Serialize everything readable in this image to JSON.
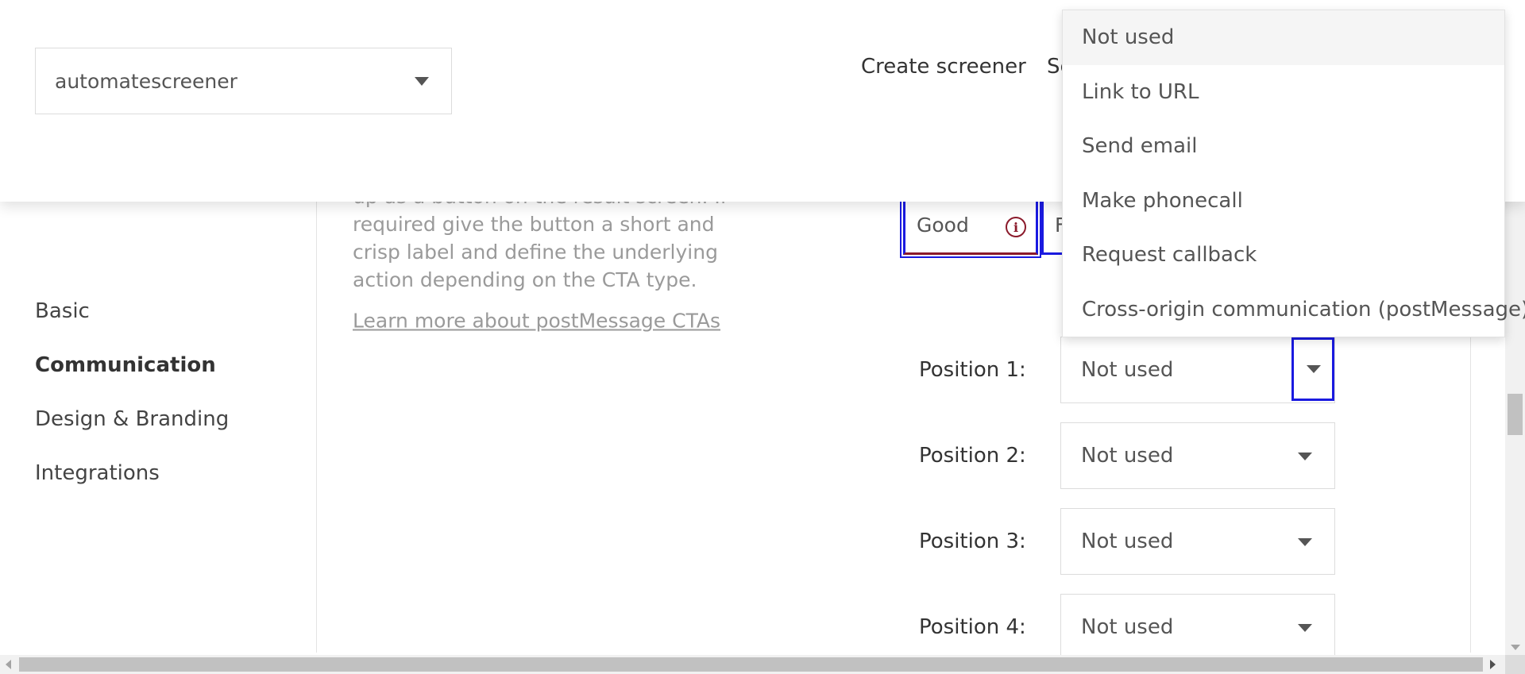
{
  "header": {
    "screener_select": {
      "value": "automatescreener"
    },
    "nav": [
      {
        "label": "Create screener"
      },
      {
        "label": "Sc"
      }
    ]
  },
  "sidebar": {
    "items": [
      {
        "label": "Basic",
        "active": false
      },
      {
        "label": "Communication",
        "active": true
      },
      {
        "label": "Design & Branding",
        "active": false
      },
      {
        "label": "Integrations",
        "active": false
      }
    ]
  },
  "description": {
    "clipped_line": "up as a button on the result screen. If",
    "text": "required give the button a short and crisp label and define the underlying action depending on the CTA type.",
    "link": "Learn more about postMessage CTAs"
  },
  "rating": {
    "good_label": "Good",
    "info_icon": "i",
    "next_label": "F"
  },
  "positions": [
    {
      "label": "Position 1:",
      "value": "Not used"
    },
    {
      "label": "Position 2:",
      "value": "Not used"
    },
    {
      "label": "Position 3:",
      "value": "Not used"
    },
    {
      "label": "Position 4:",
      "value": "Not used"
    }
  ],
  "dropdown": {
    "options": [
      "Not used",
      "Link to URL",
      "Send email",
      "Make phonecall",
      "Request callback",
      "Cross-origin communication (postMessage)"
    ]
  },
  "colors": {
    "focus_outline": "#1a1ae0",
    "error_accent": "#8b1a2b"
  }
}
